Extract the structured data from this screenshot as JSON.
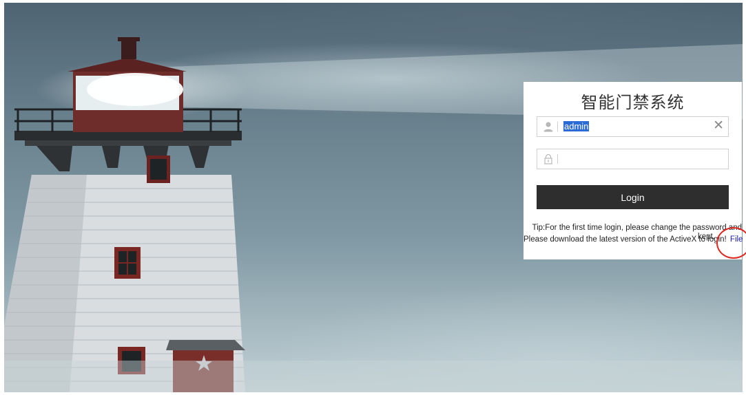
{
  "login_panel": {
    "title": "智能门禁系统",
    "username": {
      "value": "admin",
      "icon": "user-icon",
      "clear_icon": "close-icon",
      "clear_glyph": "✕"
    },
    "password": {
      "value": "",
      "icon": "lock-icon"
    },
    "login_button": "Login",
    "tip_line1": "Tip:For the first time login, please change the password and",
    "tip_line1_overflow": "kept.",
    "tip_line2": "Please download the latest version of the ActiveX to login!",
    "file_link": "File"
  },
  "background": {
    "subject": "lighthouse"
  },
  "annotation": {
    "color": "#e0261f"
  }
}
